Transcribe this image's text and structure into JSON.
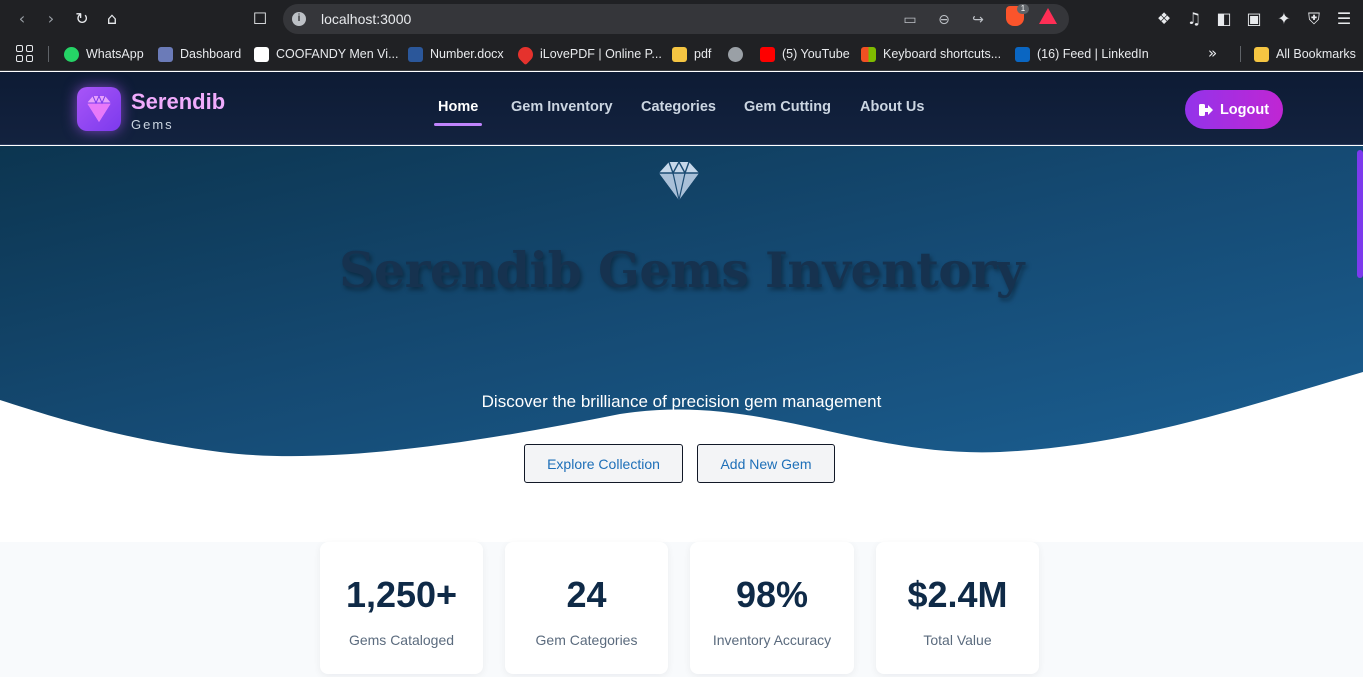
{
  "browser": {
    "url": "localhost:3000",
    "brave_badge": "1",
    "bookmarks": [
      {
        "label": "WhatsApp",
        "color": "#25d366"
      },
      {
        "label": "Dashboard",
        "color": "#6b7bb8"
      },
      {
        "label": "COOFANDY Men Vi...",
        "color": "#ffffff"
      },
      {
        "label": "Number.docx",
        "color": "#2b579a"
      },
      {
        "label": "iLovePDF | Online P...",
        "color": "#e5322d"
      },
      {
        "label": "pdf",
        "color": "#f5c542"
      },
      {
        "label": "",
        "color": "#9aa0a6"
      },
      {
        "label": "(5) YouTube",
        "color": "#ff0000"
      },
      {
        "label": "Keyboard shortcuts...",
        "color": "#f25022"
      },
      {
        "label": "(16) Feed | LinkedIn",
        "color": "#0a66c2"
      }
    ],
    "all_bookmarks": "All Bookmarks"
  },
  "site": {
    "brand": "Serendib",
    "brand_sub": "Gems",
    "nav": [
      "Home",
      "Gem Inventory",
      "Categories",
      "Gem Cutting",
      "About Us"
    ],
    "logout": "Logout",
    "accent": "#a855f7"
  },
  "hero": {
    "title": "Serendib Gems Inventory",
    "subtitle": "Discover the brilliance of precision gem management",
    "primary_button": "Explore Collection",
    "secondary_button": "Add New Gem"
  },
  "stats": [
    {
      "value": "1,250+",
      "label": "Gems Cataloged"
    },
    {
      "value": "24",
      "label": "Gem Categories"
    },
    {
      "value": "98%",
      "label": "Inventory Accuracy"
    },
    {
      "value": "$2.4M",
      "label": "Total Value"
    }
  ]
}
